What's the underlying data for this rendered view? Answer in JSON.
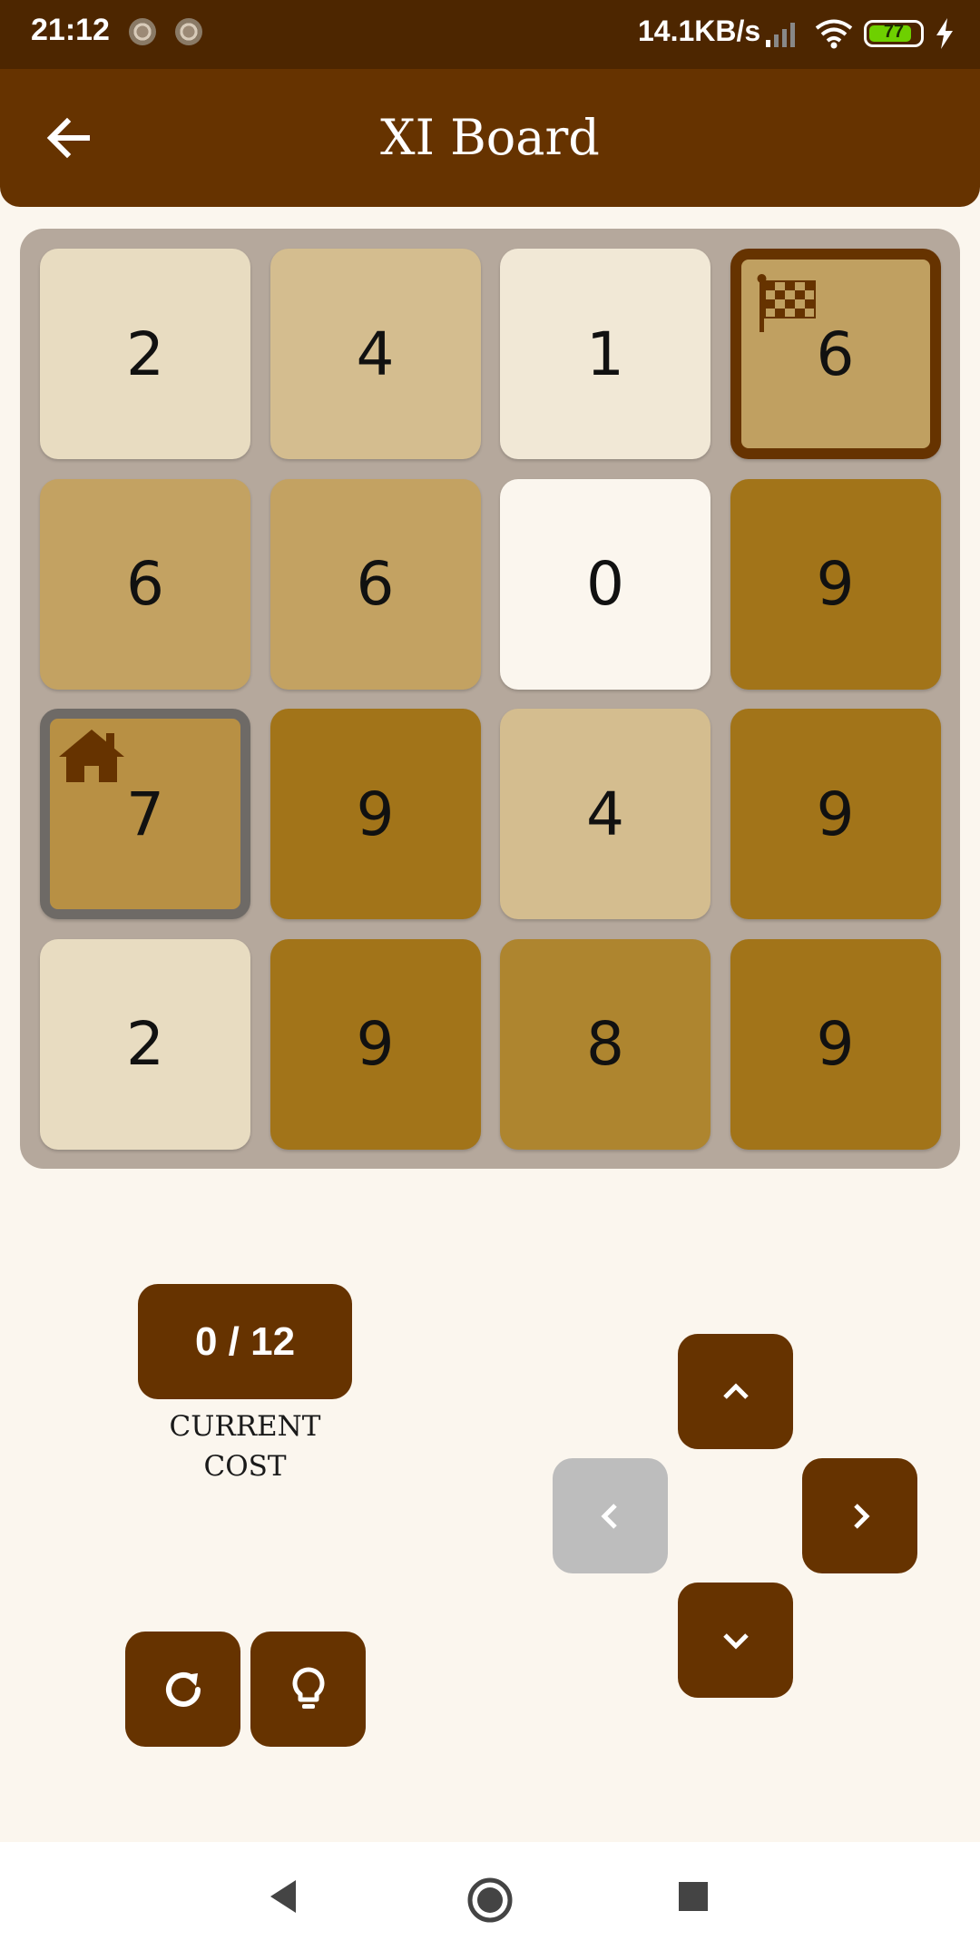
{
  "status_bar": {
    "time": "21:12",
    "network_rate": "14.1KB/s",
    "battery_level": "77"
  },
  "app_bar": {
    "title": "XI Board",
    "back_icon": "arrow-left-icon"
  },
  "board": {
    "rows": [
      [
        {
          "value": "2",
          "color": "#e8dcc1"
        },
        {
          "value": "4",
          "color": "#d4bd8f"
        },
        {
          "value": "1",
          "color": "#f1e8d6"
        },
        {
          "value": "6",
          "color": "#c0a061",
          "marker": "goal"
        }
      ],
      [
        {
          "value": "6",
          "color": "#c3a262"
        },
        {
          "value": "6",
          "color": "#c3a262"
        },
        {
          "value": "0",
          "color": "#fbf6ee"
        },
        {
          "value": "9",
          "color": "#a27419"
        }
      ],
      [
        {
          "value": "7",
          "color": "#b89044",
          "marker": "home"
        },
        {
          "value": "9",
          "color": "#a27419"
        },
        {
          "value": "4",
          "color": "#d4bd8f"
        },
        {
          "value": "9",
          "color": "#a27419"
        }
      ],
      [
        {
          "value": "2",
          "color": "#e8dcc1"
        },
        {
          "value": "9",
          "color": "#a27419"
        },
        {
          "value": "8",
          "color": "#ae852f"
        },
        {
          "value": "9",
          "color": "#a27419"
        }
      ]
    ],
    "goal_icon": "checkered-flag-icon",
    "home_icon": "home-icon"
  },
  "cost": {
    "value": "0 / 12",
    "label_line1": "CURRENT",
    "label_line2": "COST"
  },
  "controls": {
    "up_icon": "chevron-up-icon",
    "left_icon": "chevron-left-icon",
    "right_icon": "chevron-right-icon",
    "down_icon": "chevron-down-icon",
    "left_enabled": false,
    "restart_icon": "restart-icon",
    "hint_icon": "lightbulb-icon"
  },
  "colors": {
    "primary": "#663300",
    "status_bar": "#4d2600",
    "background": "#fbf6ee",
    "board_frame": "#b5a89c",
    "disabled": "#bdbdbd"
  }
}
